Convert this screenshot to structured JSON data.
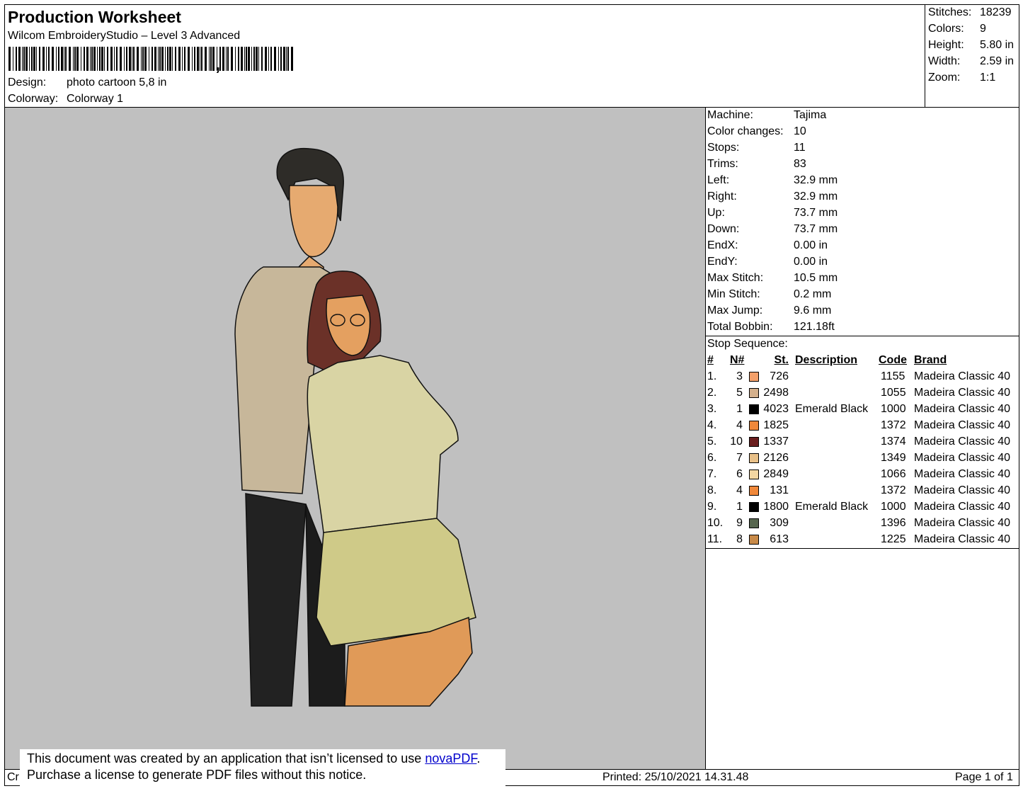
{
  "header": {
    "title": "Production Worksheet",
    "software": "Wilcom EmbroideryStudio – Level 3 Advanced",
    "barcode_suffix": ",",
    "design_label": "Design:",
    "design_value": "photo cartoon 5,8 in",
    "colorway_label": "Colorway:",
    "colorway_value": "Colorway 1"
  },
  "summary": [
    {
      "label": "Stitches:",
      "value": "18239"
    },
    {
      "label": "Colors:",
      "value": "9"
    },
    {
      "label": "Height:",
      "value": "5.80 in"
    },
    {
      "label": "Width:",
      "value": "2.59 in"
    },
    {
      "label": "Zoom:",
      "value": "1:1"
    }
  ],
  "machine_info": [
    {
      "label": "Machine:",
      "value": "Tajima"
    },
    {
      "label": "Color changes:",
      "value": "10"
    },
    {
      "label": "Stops:",
      "value": "11"
    },
    {
      "label": "Trims:",
      "value": "83"
    },
    {
      "label": "Left:",
      "value": "32.9 mm"
    },
    {
      "label": "Right:",
      "value": "32.9 mm"
    },
    {
      "label": "Up:",
      "value": "73.7 mm"
    },
    {
      "label": "Down:",
      "value": "73.7 mm"
    },
    {
      "label": "EndX:",
      "value": "0.00 in"
    },
    {
      "label": "EndY:",
      "value": "0.00 in"
    },
    {
      "label": "Max Stitch:",
      "value": "10.5 mm"
    },
    {
      "label": "Min Stitch:",
      "value": "0.2 mm"
    },
    {
      "label": "Max Jump:",
      "value": "9.6 mm"
    },
    {
      "label": "Total Bobbin:",
      "value": "121.18ft"
    }
  ],
  "stop_sequence": {
    "title": "Stop Sequence:",
    "headers": {
      "index": "#",
      "needle": "N#",
      "stitches": "St.",
      "description": "Description",
      "code": "Code",
      "brand": "Brand"
    },
    "rows": [
      {
        "index": "1.",
        "needle": "3",
        "color": "#f4a06a",
        "stitches": "726",
        "description": "",
        "code": "1155",
        "brand": "Madeira Classic 40"
      },
      {
        "index": "2.",
        "needle": "5",
        "color": "#d4b08c",
        "stitches": "2498",
        "description": "",
        "code": "1055",
        "brand": "Madeira Classic 40"
      },
      {
        "index": "3.",
        "needle": "1",
        "color": "#000000",
        "stitches": "4023",
        "description": "Emerald Black",
        "code": "1000",
        "brand": "Madeira Classic 40"
      },
      {
        "index": "4.",
        "needle": "4",
        "color": "#f0883a",
        "stitches": "1825",
        "description": "",
        "code": "1372",
        "brand": "Madeira Classic 40"
      },
      {
        "index": "5.",
        "needle": "10",
        "color": "#6a1e1e",
        "stitches": "1337",
        "description": "",
        "code": "1374",
        "brand": "Madeira Classic 40"
      },
      {
        "index": "6.",
        "needle": "7",
        "color": "#e8c088",
        "stitches": "2126",
        "description": "",
        "code": "1349",
        "brand": "Madeira Classic 40"
      },
      {
        "index": "7.",
        "needle": "6",
        "color": "#f2d6a2",
        "stitches": "2849",
        "description": "",
        "code": "1066",
        "brand": "Madeira Classic 40"
      },
      {
        "index": "8.",
        "needle": "4",
        "color": "#f0883a",
        "stitches": "131",
        "description": "",
        "code": "1372",
        "brand": "Madeira Classic 40"
      },
      {
        "index": "9.",
        "needle": "1",
        "color": "#000000",
        "stitches": "1800",
        "description": "Emerald Black",
        "code": "1000",
        "brand": "Madeira Classic 40"
      },
      {
        "index": "10.",
        "needle": "9",
        "color": "#56664e",
        "stitches": "309",
        "description": "",
        "code": "1396",
        "brand": "Madeira Classic 40"
      },
      {
        "index": "11.",
        "needle": "8",
        "color": "#c88a48",
        "stitches": "613",
        "description": "",
        "code": "1225",
        "brand": "Madeira Classic 40"
      }
    ]
  },
  "footer": {
    "left_text": "Cr",
    "printed": "Printed: 25/10/2021 14.31.48",
    "page": "Page 1 of 1"
  },
  "notice": {
    "line1_prefix": "This document was created by an application that isn’t licensed to use ",
    "link": "novaPDF",
    "line1_suffix": ".",
    "line2": "Purchase a license to generate PDF files without this notice."
  },
  "colors": {
    "preview_bg": "#c0c0c0"
  }
}
